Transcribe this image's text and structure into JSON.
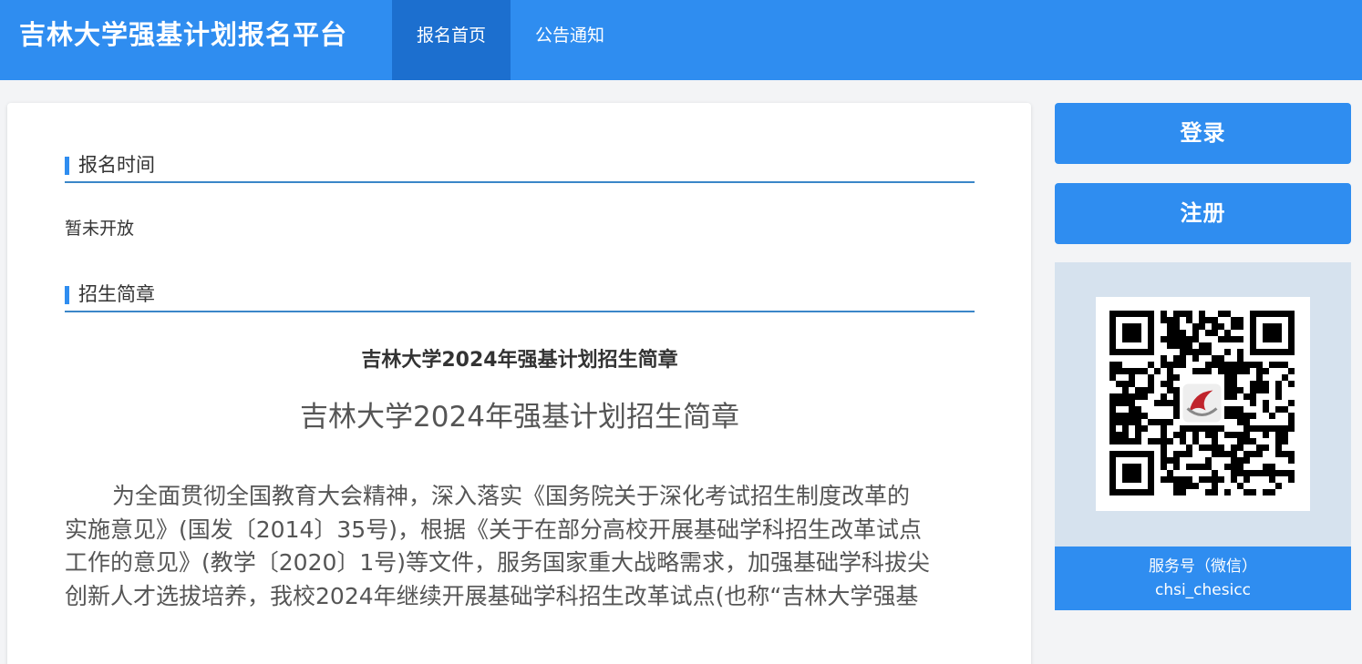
{
  "header": {
    "site_title": "吉林大学强基计划报名平台",
    "nav": [
      {
        "label": "报名首页",
        "active": true
      },
      {
        "label": "公告通知",
        "active": false
      }
    ]
  },
  "main": {
    "sections": [
      {
        "title": "报名时间",
        "content": "暂未开放"
      },
      {
        "title": "招生简章"
      }
    ],
    "doc_title_small": "吉林大学2024年强基计划招生简章",
    "doc_title_large": "吉林大学2024年强基计划招生简章",
    "doc_lines": [
      "为全面贯彻全国教育大会精神，深入落实《国务院关于深化考试招生制度改革的",
      "实施意见》(国发〔2014〕35号)，根据《关于在部分高校开展基础学科招生改革试点",
      "工作的意见》(教学〔2020〕1号)等文件，服务国家重大战略需求，加强基础学科拔尖",
      "创新人才选拔培养，我校2024年继续开展基础学科招生改革试点(也称“吉林大学强基"
    ]
  },
  "sidebar": {
    "login_label": "登录",
    "register_label": "注册",
    "qr_caption_line1": "服务号（微信）",
    "qr_caption_line2": "chsi_chesicc",
    "qr_icon": "qr-code-icon",
    "logo_icon": "chsi-logo-icon"
  },
  "colors": {
    "primary": "#2f8df0",
    "nav_active": "#1c6fcf",
    "section_rule": "#3a86c8",
    "qr_panel_bg": "#d6e2ee",
    "page_bg": "#f3f4f6"
  }
}
